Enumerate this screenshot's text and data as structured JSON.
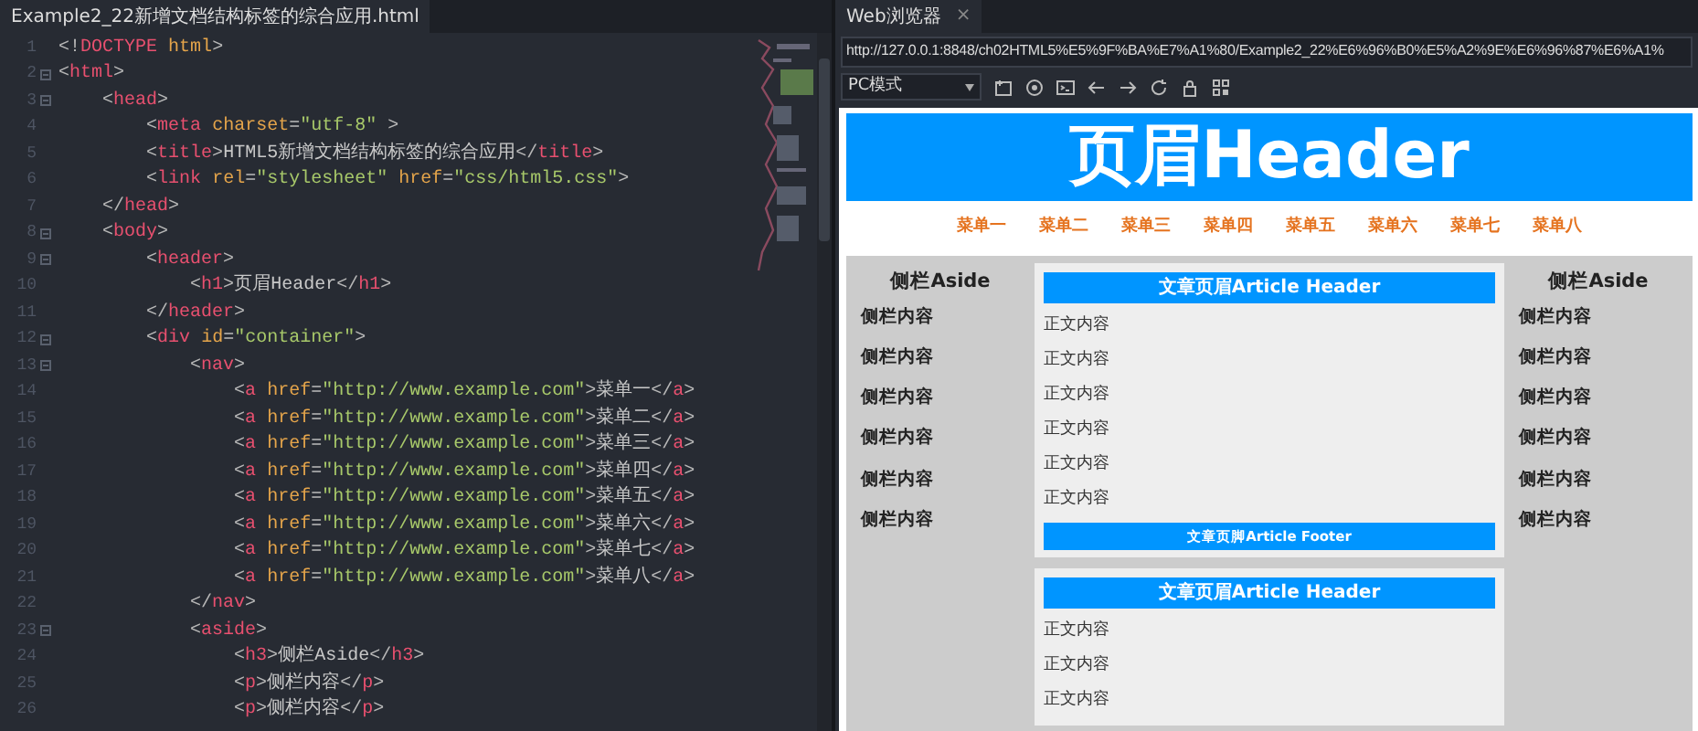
{
  "editor": {
    "tab_title": "Example2_22新增文档结构标签的综合应用.html",
    "lines": [
      {
        "number": "1",
        "text": "<!DOCTYPE html>",
        "foldable": false
      },
      {
        "number": "2",
        "text": "<html>",
        "foldable": true
      },
      {
        "number": "3",
        "text": "    <head>",
        "foldable": true
      },
      {
        "number": "4",
        "text": "        <meta charset=\"utf-8\" >",
        "foldable": false
      },
      {
        "number": "5",
        "text": "        <title>HTML5新增文档结构标签的综合应用</title>",
        "foldable": false
      },
      {
        "number": "6",
        "text": "        <link rel=\"stylesheet\" href=\"css/html5.css\">",
        "foldable": false
      },
      {
        "number": "7",
        "text": "    </head>",
        "foldable": false
      },
      {
        "number": "8",
        "text": "    <body>",
        "foldable": true
      },
      {
        "number": "9",
        "text": "        <header>",
        "foldable": true
      },
      {
        "number": "10",
        "text": "            <h1>页眉Header</h1>",
        "foldable": false
      },
      {
        "number": "11",
        "text": "        </header>",
        "foldable": false
      },
      {
        "number": "12",
        "text": "        <div id=\"container\">",
        "foldable": true
      },
      {
        "number": "13",
        "text": "            <nav>",
        "foldable": true
      },
      {
        "number": "14",
        "text": "                <a href=\"http://www.example.com\">菜单一</a>",
        "foldable": false
      },
      {
        "number": "15",
        "text": "                <a href=\"http://www.example.com\">菜单二</a>",
        "foldable": false
      },
      {
        "number": "16",
        "text": "                <a href=\"http://www.example.com\">菜单三</a>",
        "foldable": false
      },
      {
        "number": "17",
        "text": "                <a href=\"http://www.example.com\">菜单四</a>",
        "foldable": false
      },
      {
        "number": "18",
        "text": "                <a href=\"http://www.example.com\">菜单五</a>",
        "foldable": false
      },
      {
        "number": "19",
        "text": "                <a href=\"http://www.example.com\">菜单六</a>",
        "foldable": false
      },
      {
        "number": "20",
        "text": "                <a href=\"http://www.example.com\">菜单七</a>",
        "foldable": false
      },
      {
        "number": "21",
        "text": "                <a href=\"http://www.example.com\">菜单八</a>",
        "foldable": false
      },
      {
        "number": "22",
        "text": "            </nav>",
        "foldable": false
      },
      {
        "number": "23",
        "text": "            <aside>",
        "foldable": true
      },
      {
        "number": "24",
        "text": "                <h3>侧栏Aside</h3>",
        "foldable": false
      },
      {
        "number": "25",
        "text": "                <p>侧栏内容</p>",
        "foldable": false
      },
      {
        "number": "26",
        "text": "                <p>侧栏内容</p>",
        "foldable": false
      }
    ]
  },
  "browser": {
    "tab_title": "Web浏览器",
    "tab_close": "×",
    "url": "http://127.0.0.1:8848/ch02HTML5%E5%9F%BA%E7%A1%80/Example2_22%E6%96%B0%E5%A2%9E%E6%96%87%E6%A1%",
    "mode_select": "PC模式",
    "page": {
      "header": "页眉Header",
      "nav": [
        "菜单一",
        "菜单二",
        "菜单三",
        "菜单四",
        "菜单五",
        "菜单六",
        "菜单七",
        "菜单八"
      ],
      "aside_left": {
        "title": "侧栏Aside",
        "items": [
          "侧栏内容",
          "侧栏内容",
          "侧栏内容",
          "侧栏内容",
          "侧栏内容",
          "侧栏内容"
        ]
      },
      "articles": [
        {
          "header": "文章页眉Article Header",
          "paragraphs": [
            "正文内容",
            "正文内容",
            "正文内容",
            "正文内容",
            "正文内容",
            "正文内容"
          ],
          "footer": "文章页脚Article Footer"
        },
        {
          "header": "文章页眉Article Header",
          "paragraphs": [
            "正文内容",
            "正文内容",
            "正文内容"
          ]
        }
      ],
      "aside_right": {
        "title": "侧栏Aside",
        "items": [
          "侧栏内容",
          "侧栏内容",
          "侧栏内容",
          "侧栏内容",
          "侧栏内容",
          "侧栏内容"
        ]
      }
    }
  }
}
